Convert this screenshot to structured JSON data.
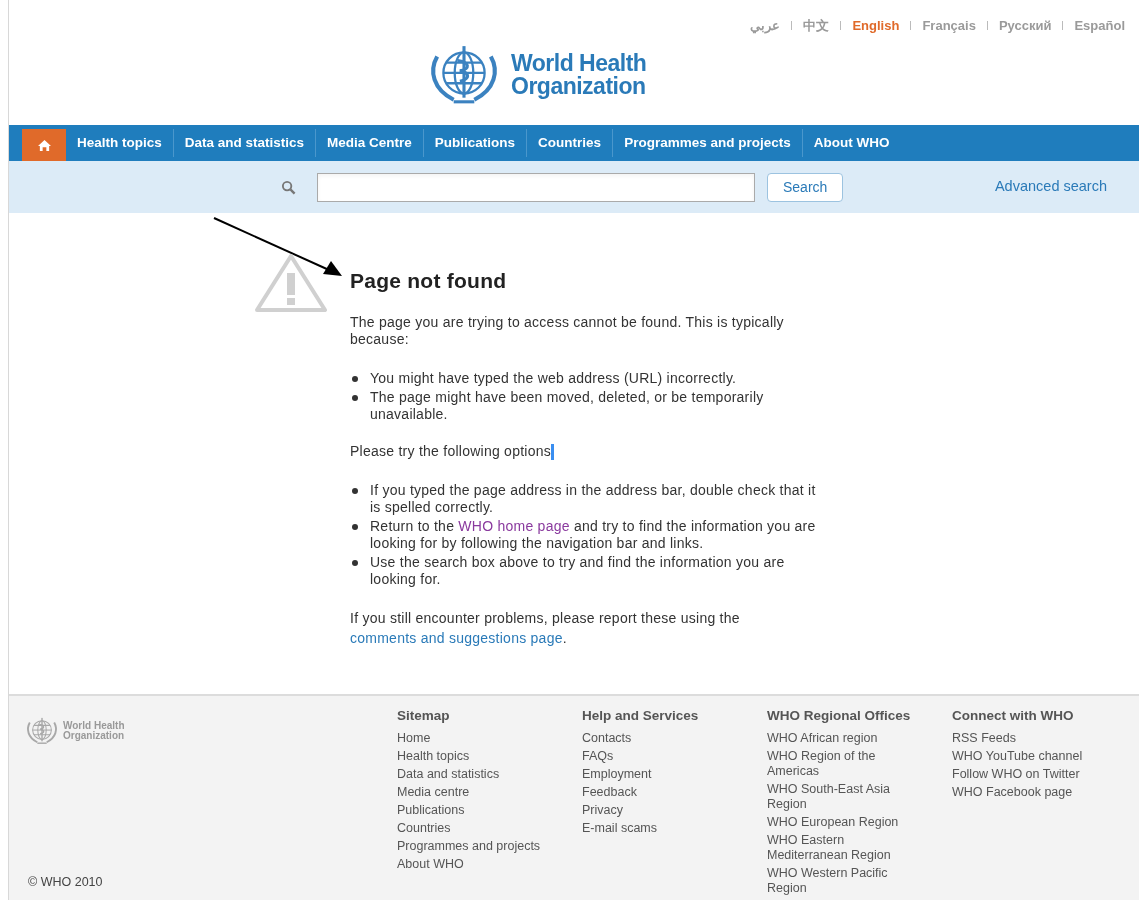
{
  "languages": [
    {
      "label": "عربي",
      "selected": false
    },
    {
      "label": "中文",
      "selected": false
    },
    {
      "label": "English",
      "selected": true
    },
    {
      "label": "Français",
      "selected": false
    },
    {
      "label": "Русский",
      "selected": false
    },
    {
      "label": "Español",
      "selected": false
    }
  ],
  "logo": {
    "line_1": "World Health",
    "line_2": "Organization"
  },
  "nav": {
    "items": [
      "Health topics",
      "Data and statistics",
      "Media Centre",
      "Publications",
      "Countries",
      "Programmes and projects",
      "About WHO"
    ]
  },
  "search": {
    "button": "Search",
    "advanced_link": "Advanced search"
  },
  "content": {
    "title": "Page not found",
    "intro": "The page you are trying to access cannot be found. This is typically because:",
    "reasons": [
      {
        "text": "You might have typed the web address (URL) incorrectly."
      },
      {
        "text": "The page might have been moved, deleted, or be temporarily unavailable."
      }
    ],
    "options_intro": "Please try the following options",
    "cursor_visible": true,
    "options": [
      {
        "text": "If you typed the page address in the address bar, double check that it is spelled correctly."
      },
      {
        "before": "Return to the ",
        "link": "WHO home page",
        "after": " and try to find the information you are looking for by following the navigation bar and links."
      },
      {
        "text": "Use the search box above to try and find the information you are looking for."
      }
    ],
    "problems": "If you still encounter problems, please report these using the",
    "problems_link": "comments and suggestions page",
    "problems_end": "."
  },
  "footer": {
    "logo": {
      "line_1": "World Health",
      "line_2": "Organization"
    },
    "copyright": "© WHO 2010",
    "columns": [
      {
        "heading": "Sitemap",
        "links": [
          "Home",
          "Health topics",
          "Data and statistics",
          "Media centre",
          "Publications",
          "Countries",
          "Programmes and projects",
          "About WHO"
        ]
      },
      {
        "heading": "Help and Services",
        "links": [
          "Contacts",
          "FAQs",
          "Employment",
          "Feedback",
          "Privacy",
          "E-mail scams"
        ]
      },
      {
        "heading": "WHO Regional Offices",
        "links": [
          "WHO African region",
          "WHO Region of the Americas",
          "WHO South-East Asia Region",
          "WHO European Region",
          "WHO Eastern Mediterranean Region",
          "WHO Western Pacific Region"
        ]
      },
      {
        "heading": "Connect with WHO",
        "links": [
          "RSS Feeds",
          "WHO YouTube channel",
          "Follow WHO on Twitter",
          "WHO Facebook page"
        ]
      }
    ]
  }
}
